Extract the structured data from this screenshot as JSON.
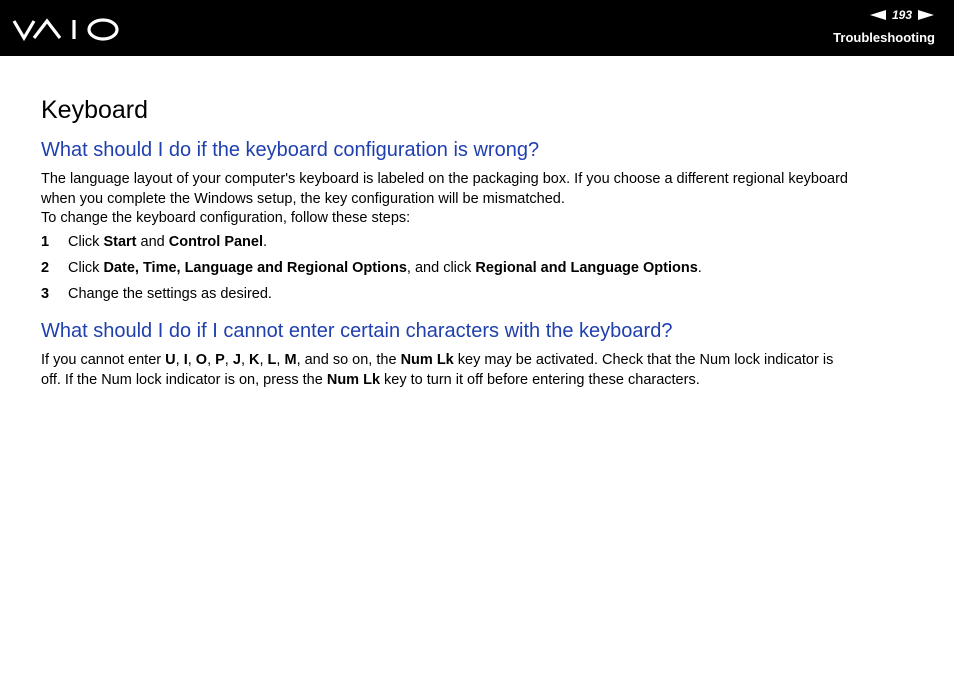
{
  "header": {
    "logo_text": "VAIO",
    "page_number": "193",
    "section": "Troubleshooting",
    "background_color": "#000000"
  },
  "page_title": "Keyboard",
  "accent_color": "#1f3fae",
  "q1": {
    "heading": "What should I do if the keyboard configuration is wrong?",
    "para1_line1": "The language layout of your computer's keyboard is labeled on the packaging box. If you choose a different regional keyboard",
    "para1_line2": "when you complete the Windows setup, the key configuration will be mismatched.",
    "para2": "To change the keyboard configuration, follow these steps:",
    "steps": [
      {
        "num": "1",
        "t1": "Click ",
        "b1": "Start",
        "t2": " and ",
        "b2": "Control Panel",
        "t3": "."
      },
      {
        "num": "2",
        "t1": "Click ",
        "b1": "Date, Time, Language and Regional Options",
        "t2": ", and click ",
        "b2": "Regional and Language Options",
        "t3": "."
      },
      {
        "num": "3",
        "t1": "Change the settings as desired."
      }
    ]
  },
  "q2": {
    "heading": "What should I do if I cannot enter certain characters with the keyboard?",
    "s1": "If you cannot enter ",
    "k_u": "U",
    "k_i": "I",
    "k_o": "O",
    "k_p": "P",
    "k_j": "J",
    "k_k": "K",
    "k_l": "L",
    "k_m": "M",
    "sep": ", ",
    "s2": ", and so on, the ",
    "numlk": "Num Lk",
    "s3": " key may be activated. Check that the Num lock indicator is",
    "s4": "off. If the Num lock indicator is on, press the ",
    "s5": " key to turn it off before entering these characters."
  }
}
